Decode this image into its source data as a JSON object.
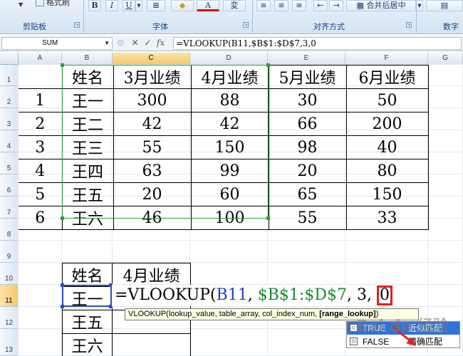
{
  "ribbon": {
    "format_painter_label": "格式刷",
    "bold": "B",
    "italic": "I",
    "underline": "U",
    "merge_center_label": "合并后居中",
    "groups": {
      "clipboard": "剪贴板",
      "font": "字体",
      "alignment": "对齐方式",
      "number": "数字"
    }
  },
  "formula_bar": {
    "name_box": "SUM",
    "cancel_icon": "✕",
    "enter_icon": "✓",
    "fx_label": "fx",
    "content": "=VLOOKUP(B11,$B$1:$D$7,3,0"
  },
  "columns": [
    "A",
    "B",
    "C",
    "D",
    "E",
    "F",
    "G"
  ],
  "rows": [
    "1",
    "2",
    "3",
    "4",
    "5",
    "6",
    "7",
    "8",
    "9",
    "10",
    "11",
    "12",
    "13"
  ],
  "main_table": {
    "headers": [
      "",
      "姓名",
      "3月业绩",
      "4月业绩",
      "5月业绩",
      "6月业绩"
    ],
    "rows": [
      [
        "1",
        "王一",
        "300",
        "88",
        "30",
        "50"
      ],
      [
        "2",
        "王二",
        "42",
        "42",
        "66",
        "200"
      ],
      [
        "3",
        "王三",
        "55",
        "150",
        "98",
        "40"
      ],
      [
        "4",
        "王四",
        "63",
        "99",
        "20",
        "80"
      ],
      [
        "5",
        "王五",
        "20",
        "60",
        "65",
        "150"
      ],
      [
        "6",
        "王六",
        "46",
        "100",
        "55",
        "33"
      ]
    ]
  },
  "lookup_table": {
    "headers": [
      "姓名",
      "4月业绩"
    ],
    "names": [
      "王一",
      "王五",
      "王六"
    ]
  },
  "edit_formula": {
    "prefix": "=VLOOKUP(",
    "arg1": "B11",
    "sep1": ", ",
    "arg2": "$B$1:$D$7",
    "sep2": ", 3, ",
    "arg4": "0"
  },
  "tooltip": {
    "text": "VLOOKUP(lookup_value, table_array, col_index_num, ",
    "current_arg": "[range_lookup]",
    "close": ")"
  },
  "autocomplete": [
    {
      "text": "TRUE",
      "desc": "近似匹配",
      "selected": true
    },
    {
      "text": "FALSE",
      "desc": "精确匹配",
      "selected": false
    }
  ],
  "watermark": "Bai du 经验",
  "colors": {
    "range_highlight": "#2e9e3c",
    "active_cell": "#2b4fc2",
    "annotation": "#e02020",
    "tooltip_bg": "#ffffe1"
  }
}
